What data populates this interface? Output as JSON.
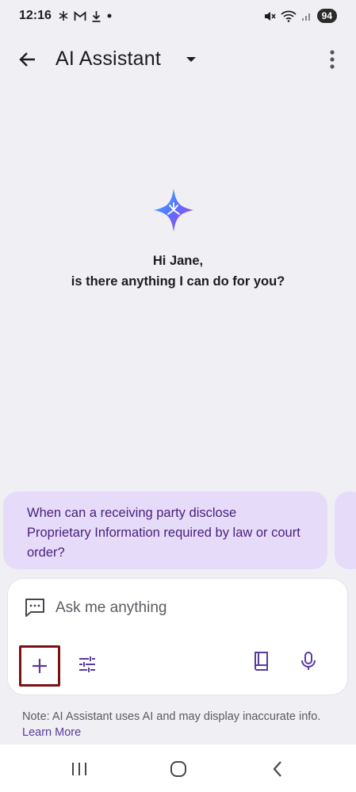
{
  "status_bar": {
    "time": "12:16",
    "battery": "94"
  },
  "app_bar": {
    "title": "AI Assistant"
  },
  "greeting": {
    "line1": "Hi Jane,",
    "line2": "is there anything I can do for you?"
  },
  "suggestions": [
    {
      "text": "When can a receiving party disclose Proprietary Information required by law or court order?"
    }
  ],
  "input": {
    "placeholder": "Ask me anything"
  },
  "note": {
    "text": "Note: AI Assistant uses AI and may display inaccurate info.",
    "link": "Learn More"
  },
  "colors": {
    "background": "#f0eff4",
    "suggestion_bg": "#e6dcfa",
    "suggestion_text": "#4a1e7a",
    "accent": "#5a3aa0",
    "highlight_border": "#7a0f14"
  },
  "icons": {
    "back": "arrow-left-icon",
    "caret": "caret-down-icon",
    "more": "more-vertical-icon",
    "sparkle": "sparkle-star-icon",
    "chat": "chat-bubble-icon",
    "plus": "plus-icon",
    "tune": "sliders-icon",
    "book": "book-icon",
    "mic": "microphone-icon"
  }
}
